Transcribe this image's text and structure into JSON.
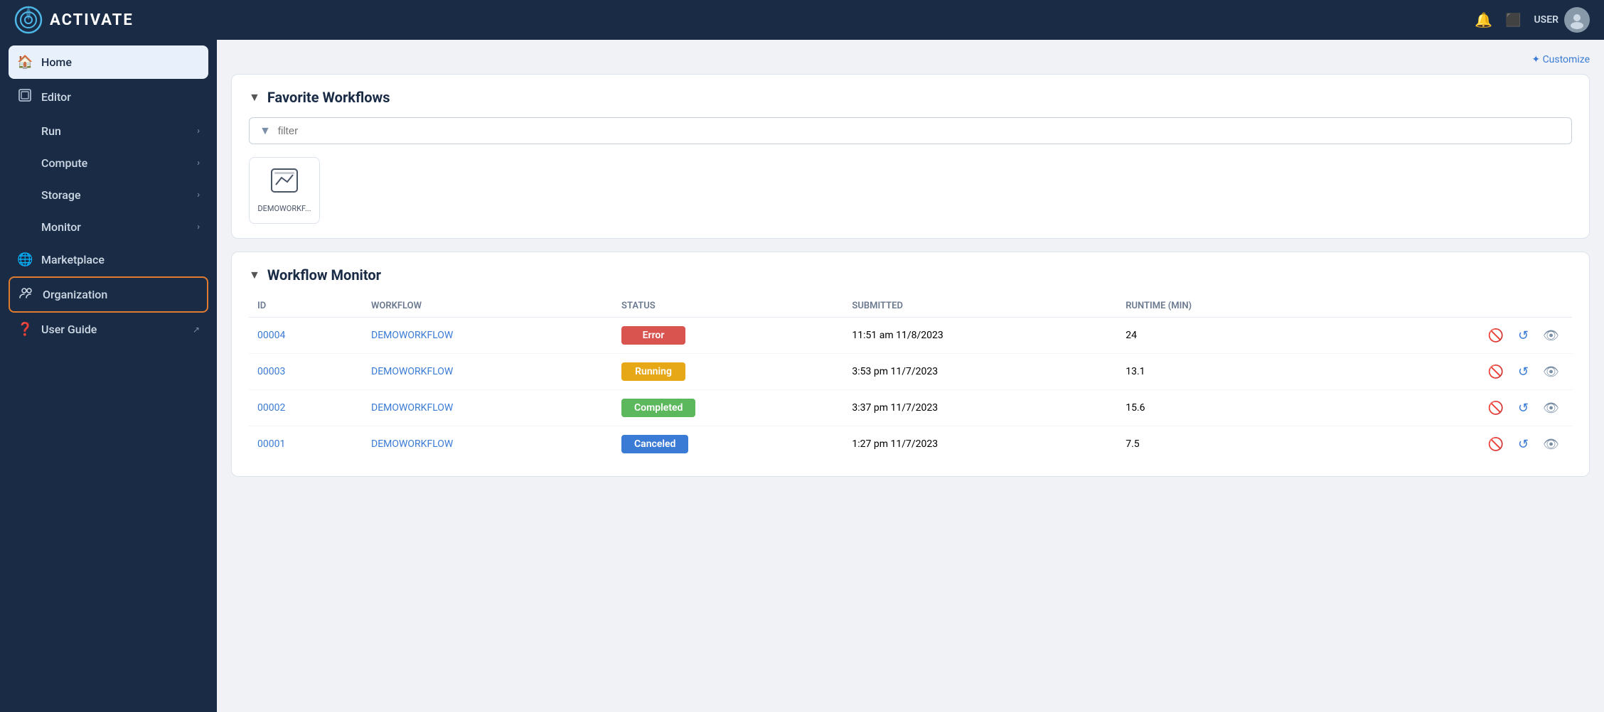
{
  "topbar": {
    "logo_text": "ACTIVATE",
    "user_label": "USER"
  },
  "sidebar": {
    "items": [
      {
        "id": "home",
        "label": "Home",
        "icon": "🏠",
        "active": true,
        "chevron": false,
        "outline": false
      },
      {
        "id": "editor",
        "label": "Editor",
        "icon": "⬜",
        "active": false,
        "chevron": false,
        "outline": false
      },
      {
        "id": "run",
        "label": "Run",
        "icon": "",
        "active": false,
        "chevron": true,
        "outline": false
      },
      {
        "id": "compute",
        "label": "Compute",
        "icon": "",
        "active": false,
        "chevron": true,
        "outline": false
      },
      {
        "id": "storage",
        "label": "Storage",
        "icon": "",
        "active": false,
        "chevron": true,
        "outline": false
      },
      {
        "id": "monitor",
        "label": "Monitor",
        "icon": "",
        "active": false,
        "chevron": true,
        "outline": false
      },
      {
        "id": "marketplace",
        "label": "Marketplace",
        "icon": "🌐",
        "active": false,
        "chevron": false,
        "outline": false
      },
      {
        "id": "organization",
        "label": "Organization",
        "icon": "👥",
        "active": false,
        "chevron": false,
        "outline": true
      },
      {
        "id": "user-guide",
        "label": "User Guide",
        "icon": "❓",
        "active": false,
        "chevron": false,
        "outline": false,
        "external": true
      }
    ]
  },
  "customize": {
    "label": "✦ Customize"
  },
  "favorite_workflows": {
    "title": "Favorite Workflows",
    "filter_placeholder": "filter",
    "workflow_card_label": "DEMOWORKF..."
  },
  "workflow_monitor": {
    "title": "Workflow Monitor",
    "columns": [
      "ID",
      "WORKFLOW",
      "STATUS",
      "SUBMITTED",
      "RUNTIME (MIN)"
    ],
    "rows": [
      {
        "id": "00004",
        "workflow": "DEMOWORKFLOW",
        "status": "Error",
        "status_type": "error",
        "submitted": "11:51 am 11/8/2023",
        "runtime": "24"
      },
      {
        "id": "00003",
        "workflow": "DEMOWORKFLOW",
        "status": "Running",
        "status_type": "running",
        "submitted": "3:53 pm 11/7/2023",
        "runtime": "13.1"
      },
      {
        "id": "00002",
        "workflow": "DEMOWORKFLOW",
        "status": "Completed",
        "status_type": "completed",
        "submitted": "3:37 pm 11/7/2023",
        "runtime": "15.6"
      },
      {
        "id": "00001",
        "workflow": "DEMOWORKFLOW",
        "status": "Canceled",
        "status_type": "canceled",
        "submitted": "1:27 pm 11/7/2023",
        "runtime": "7.5"
      }
    ]
  }
}
